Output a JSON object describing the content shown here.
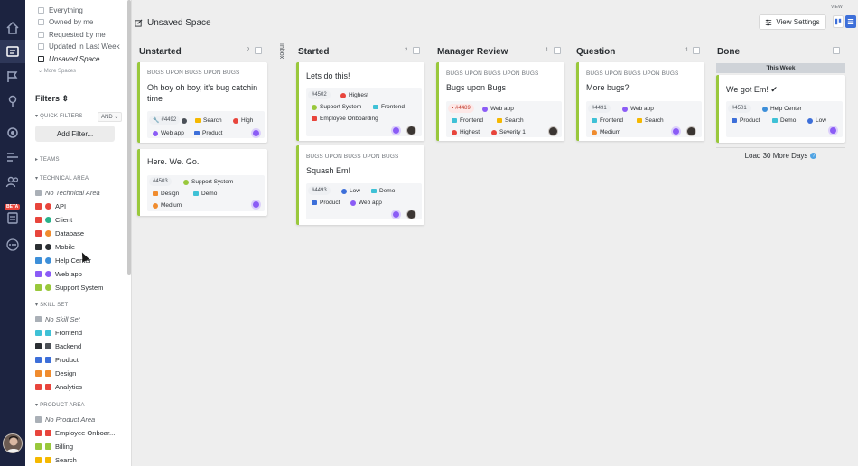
{
  "rail": {
    "icons": [
      "home-icon",
      "spaces-icon",
      "roadmap-icon",
      "location-icon",
      "settings-icon",
      "list-icon",
      "people-icon",
      "beta-icon",
      "more-icon"
    ],
    "beta_label": "BETA"
  },
  "sidebar": {
    "nav": [
      {
        "label": "Everything"
      },
      {
        "label": "Owned by me"
      },
      {
        "label": "Requested by me"
      },
      {
        "label": "Updated in Last Week"
      },
      {
        "label": "Unsaved Space"
      }
    ],
    "more_spaces": "More Spaces",
    "filters_title": "Filters",
    "quick_filters": "QUICK FILTERS",
    "and_label": "AND",
    "add_filter": "Add Filter...",
    "teams": "TEAMS",
    "technical_area": {
      "title": "TECHNICAL AREA",
      "items": [
        "No Technical Area",
        "API",
        "Client",
        "Database",
        "Mobile",
        "Help Center",
        "Web app",
        "Support System"
      ]
    },
    "skill_set": {
      "title": "SKILL SET",
      "items": [
        "No Skill Set",
        "Frontend",
        "Backend",
        "Product",
        "Design",
        "Analytics"
      ]
    },
    "product_area": {
      "title": "PRODUCT AREA",
      "items": [
        "No Product Area",
        "Employee Onboar...",
        "Billing",
        "Search"
      ]
    }
  },
  "header": {
    "title": "Unsaved Space",
    "view_settings": "View Settings",
    "view_label": "VIEW",
    "inbox": "Inbox"
  },
  "columns": [
    {
      "title": "Unstarted",
      "count": "2"
    },
    {
      "title": "Started",
      "count": "2"
    },
    {
      "title": "Manager Review",
      "count": "1"
    },
    {
      "title": "Question",
      "count": "1"
    },
    {
      "title": "Done",
      "count": ""
    }
  ],
  "cards": {
    "c1": {
      "eyebrow": "BUGS UPON BUGS UPON BUGS",
      "title": "Oh boy oh boy, it's bug catchin time",
      "id": "#4492",
      "tags": [
        "Search",
        "High",
        "Web app",
        "Product"
      ]
    },
    "c2": {
      "title": "Here. We. Go.",
      "id": "#4503",
      "tags": [
        "Support System",
        "Design",
        "Demo",
        "Medium"
      ]
    },
    "c3": {
      "title": "Lets do this!",
      "id": "#4502",
      "tags": [
        "Highest",
        "Support System",
        "Frontend",
        "Employee Onboarding"
      ]
    },
    "c4": {
      "eyebrow": "BUGS UPON BUGS UPON BUGS",
      "title": "Squash Em!",
      "id": "#4493",
      "tags": [
        "Low",
        "Demo",
        "Product",
        "Web app"
      ]
    },
    "c5": {
      "eyebrow": "BUGS UPON BUGS UPON BUGS",
      "title": "Bugs upon Bugs",
      "id": "#4489",
      "tags": [
        "Web app",
        "Frontend",
        "Search",
        "Highest",
        "Severity 1"
      ]
    },
    "c6": {
      "eyebrow": "BUGS UPON BUGS UPON BUGS",
      "title": "More bugs?",
      "id": "#4491",
      "tags": [
        "Web app",
        "Frontend",
        "Search",
        "Medium"
      ]
    },
    "c7": {
      "title": "We got Em! ✔",
      "id": "#4501",
      "tags": [
        "Help Center",
        "Product",
        "Demo",
        "Low"
      ]
    }
  },
  "done": {
    "this_week": "This Week",
    "load_more": "Load 30 More Days"
  }
}
